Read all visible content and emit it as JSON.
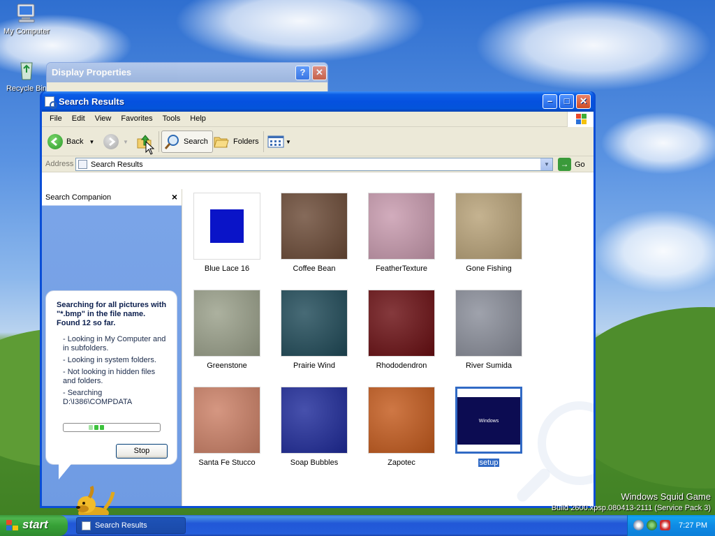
{
  "desktop": {
    "icons": [
      {
        "label": "My Computer",
        "icon": "computer-icon"
      },
      {
        "label": "Recycle Bin",
        "icon": "recycle-bin-icon"
      }
    ],
    "branding": "Windows Squid Game",
    "build_info": "Build 2600.xpsp.080413-2111 (Service Pack 3)"
  },
  "background_window": {
    "title": "Display Properties"
  },
  "window": {
    "title": "Search Results",
    "menu": [
      "File",
      "Edit",
      "View",
      "Favorites",
      "Tools",
      "Help"
    ],
    "toolbar": {
      "back": "Back",
      "search": "Search",
      "folders": "Folders"
    },
    "address": {
      "label": "Address",
      "value": "Search Results",
      "go": "Go"
    }
  },
  "search_companion": {
    "title": "Search Companion",
    "heading": "Searching for all pictures with \"*.bmp\" in the file name.  Found 12 so far.",
    "items": [
      "- Looking in My Computer and in subfolders.",
      "- Looking in system folders.",
      "- Not looking in hidden files and folders.",
      "- Searching D:\\I386\\COMPDATA"
    ],
    "stop": "Stop"
  },
  "results": [
    {
      "name": "Blue Lace 16",
      "color": "#0a14c8"
    },
    {
      "name": "Coffee Bean",
      "color": "#6b4a36"
    },
    {
      "name": "FeatherTexture",
      "color": "#c89aae"
    },
    {
      "name": "Gone Fishing",
      "color": "#b8a278"
    },
    {
      "name": "Greenstone",
      "color": "#9aa08a"
    },
    {
      "name": "Prairie Wind",
      "color": "#1f4a58"
    },
    {
      "name": "Rhododendron",
      "color": "#6a0e12"
    },
    {
      "name": "River Sumida",
      "color": "#8a8e9a"
    },
    {
      "name": "Santa Fe Stucco",
      "color": "#cc8066"
    },
    {
      "name": "Soap Bubbles",
      "color": "#1e2a9a"
    },
    {
      "name": "Zapotec",
      "color": "#c45a1c"
    },
    {
      "name": "setup",
      "color": "#0c0c52",
      "selected": true,
      "thumb_text": "Windows"
    }
  ],
  "taskbar": {
    "start": "start",
    "task": "Search Results",
    "clock": "7:27 PM"
  }
}
